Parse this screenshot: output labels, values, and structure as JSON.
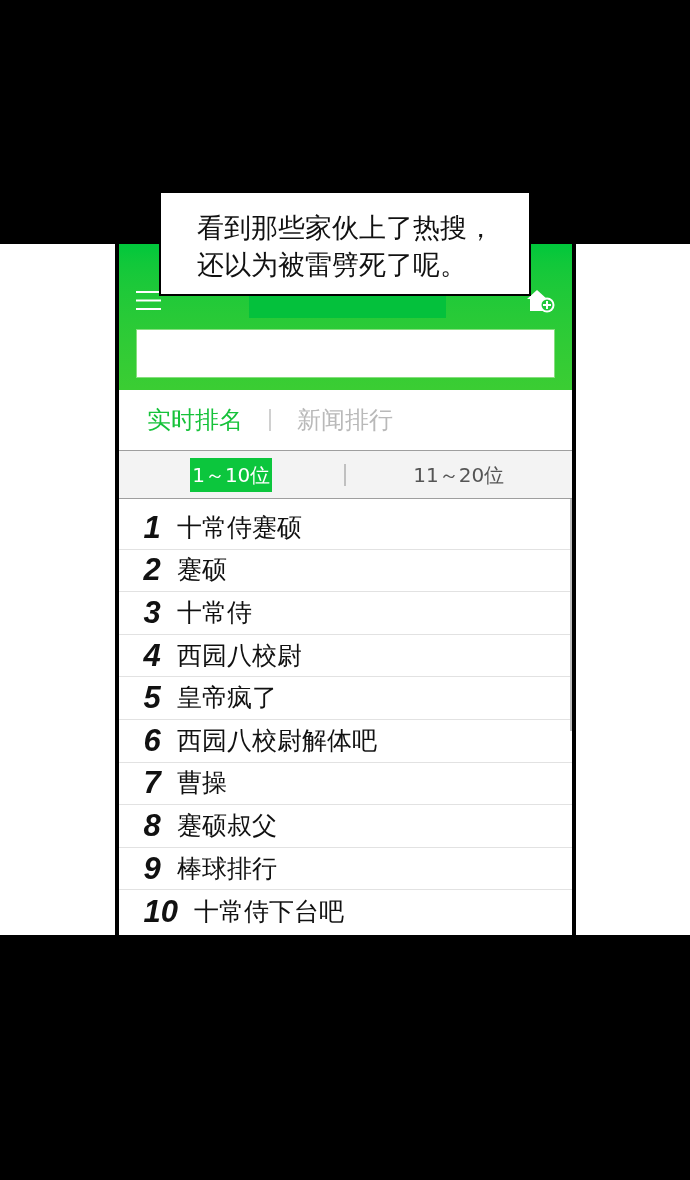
{
  "speech_bubble": {
    "lines": [
      "看到那些家伙上了热搜，",
      "还以为被雷劈死了呢。"
    ]
  },
  "tabs": [
    {
      "label": "实时排名",
      "selected": true
    },
    {
      "label": "新闻排行",
      "selected": false
    }
  ],
  "range_tabs": [
    {
      "label": "1～10位",
      "selected": true
    },
    {
      "label": "11～20位",
      "selected": false
    }
  ],
  "ranking": [
    {
      "rank": "1",
      "name": "十常侍蹇硕"
    },
    {
      "rank": "2",
      "name": "蹇硕"
    },
    {
      "rank": "3",
      "name": "十常侍"
    },
    {
      "rank": "4",
      "name": "西园八校尉"
    },
    {
      "rank": "5",
      "name": "皇帝疯了"
    },
    {
      "rank": "6",
      "name": "西园八校尉解体吧"
    },
    {
      "rank": "7",
      "name": "曹操"
    },
    {
      "rank": "8",
      "name": "蹇硕叔父"
    },
    {
      "rank": "9",
      "name": "棒球排行"
    },
    {
      "rank": "10",
      "name": "十常侍下台吧"
    }
  ]
}
